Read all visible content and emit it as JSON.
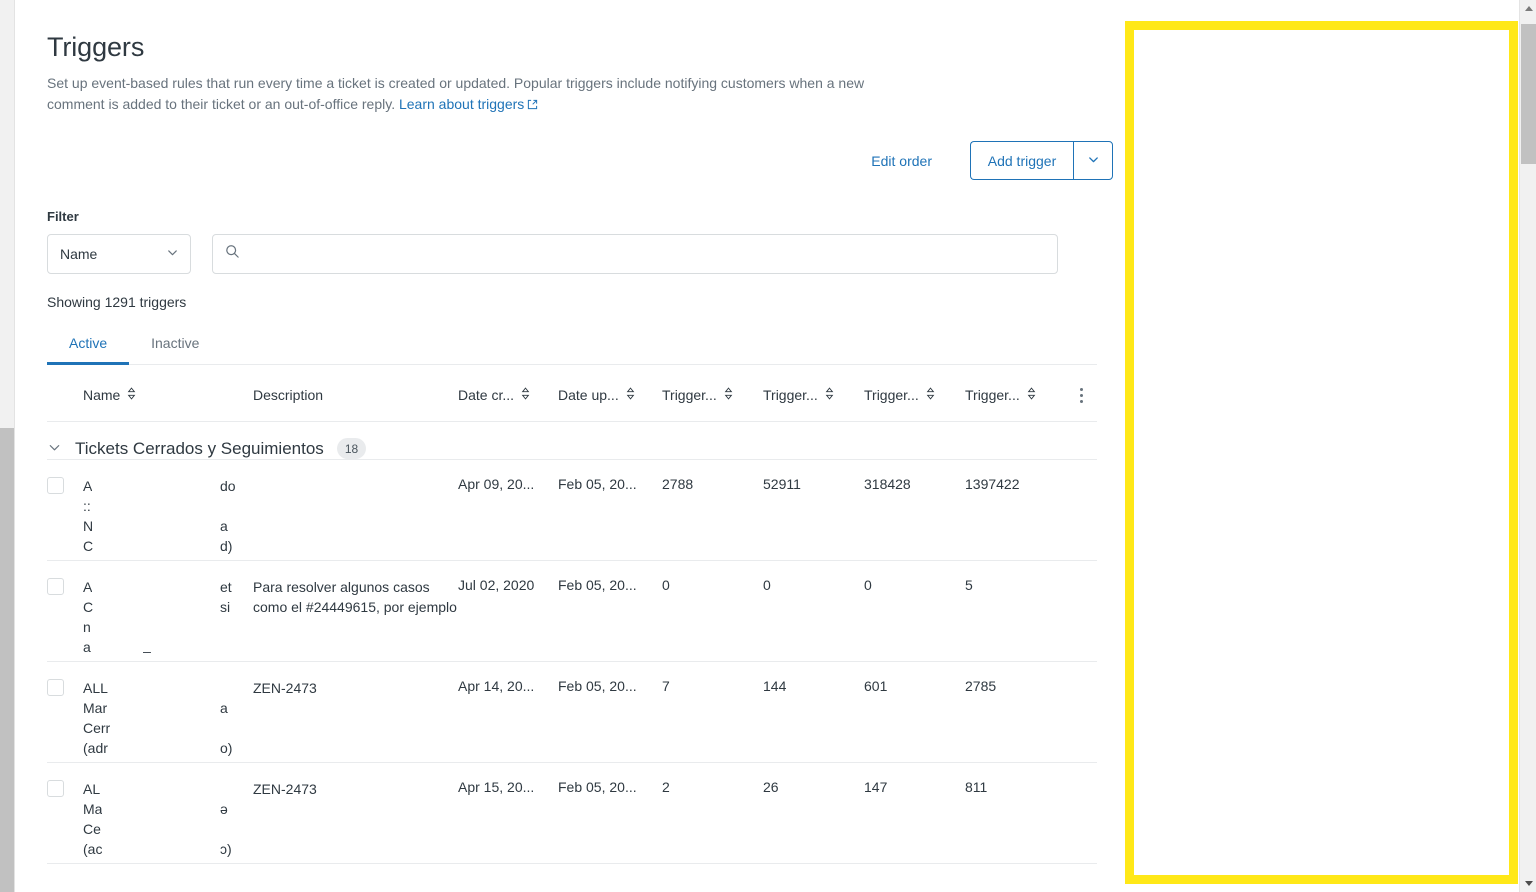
{
  "header": {
    "title": "Triggers",
    "description_part1": "Set up event-based rules that run every time a ticket is created or updated. Popular triggers include notifying customers when a new comment is added to their ticket or an out-of-office reply.",
    "learn_link": "Learn about triggers",
    "external_link_icon": "external-link-icon"
  },
  "actions": {
    "edit_order": "Edit order",
    "add_trigger": "Add trigger",
    "caret_icon": "chevron-down-icon"
  },
  "filter": {
    "label": "Filter",
    "select_value": "Name",
    "select_options": [
      "Name"
    ],
    "search_value": "",
    "search_placeholder": "",
    "search_icon": "search-icon",
    "showing_text": "Showing 1291 triggers"
  },
  "tabs": [
    {
      "label": "Active",
      "active": true
    },
    {
      "label": "Inactive",
      "active": false
    }
  ],
  "table": {
    "columns": [
      {
        "key": "name",
        "label": "Name",
        "sortable": true
      },
      {
        "key": "description",
        "label": "Description",
        "sortable": false
      },
      {
        "key": "date_created",
        "label": "Date cr...",
        "sortable": true
      },
      {
        "key": "date_updated",
        "label": "Date up...",
        "sortable": true
      },
      {
        "key": "trigger1",
        "label": "Trigger...",
        "sortable": true
      },
      {
        "key": "trigger2",
        "label": "Trigger...",
        "sortable": true
      },
      {
        "key": "trigger3",
        "label": "Trigger...",
        "sortable": true
      },
      {
        "key": "trigger4",
        "label": "Trigger...",
        "sortable": true
      }
    ],
    "column_menu_icon": "kebab-menu-icon",
    "sort_icon": "sort-arrows-icon",
    "group": {
      "name": "Tickets Cerrados y Seguimientos",
      "count": "18",
      "collapse_icon": "chevron-down-icon",
      "expanded": true
    },
    "rows": [
      {
        "name_fragments": [
          "A",
          "::",
          "N",
          "C"
        ],
        "name_fragments_right": [
          "do",
          "",
          "a",
          "d)"
        ],
        "description": "",
        "date_created": "Apr 09, 20...",
        "date_updated": "Feb 05, 20...",
        "trigger1": "2788",
        "trigger2": "52911",
        "trigger3": "318428",
        "trigger4": "1397422"
      },
      {
        "name_fragments": [
          "A",
          "C",
          "n",
          "a"
        ],
        "name_fragments_right": [
          "et",
          "si",
          "",
          "_"
        ],
        "description": "Para resolver algunos casos como el #24449615, por ejemplo",
        "date_created": "Jul 02, 2020",
        "date_updated": "Feb 05, 20...",
        "trigger1": "0",
        "trigger2": "0",
        "trigger3": "0",
        "trigger4": "5"
      },
      {
        "name_fragments": [
          "ALL",
          "Mar",
          "Cerr",
          "(adr"
        ],
        "name_fragments_right": [
          "",
          "a",
          "",
          "o)"
        ],
        "description": "ZEN-2473",
        "date_created": "Apr 14, 20...",
        "date_updated": "Feb 05, 20...",
        "trigger1": "7",
        "trigger2": "144",
        "trigger3": "601",
        "trigger4": "2785"
      },
      {
        "name_fragments": [
          "AL",
          "Mа",
          "Ce",
          "(aс"
        ],
        "name_fragments_right": [
          "",
          "ə",
          "",
          "ɔ)"
        ],
        "description": "ZEN-2473",
        "date_created": "Apr 15, 20...",
        "date_updated": "Feb 05, 20...",
        "trigger1": "2",
        "trigger2": "26",
        "trigger3": "147",
        "trigger4": "811"
      }
    ]
  },
  "overlay": {
    "name": "yellow-highlight-panel",
    "border_color": "#ffe818",
    "background": "#ffffff"
  },
  "scrollbars": {
    "right_up_arrow_icon": "scroll-up-arrow-icon",
    "right_down_arrow_icon": "scroll-down-arrow-icon"
  },
  "colors": {
    "accent": "#1f73b7",
    "text": "#2f3941",
    "muted": "#68737d",
    "border": "#e9ebed",
    "highlight": "#ffe818"
  }
}
